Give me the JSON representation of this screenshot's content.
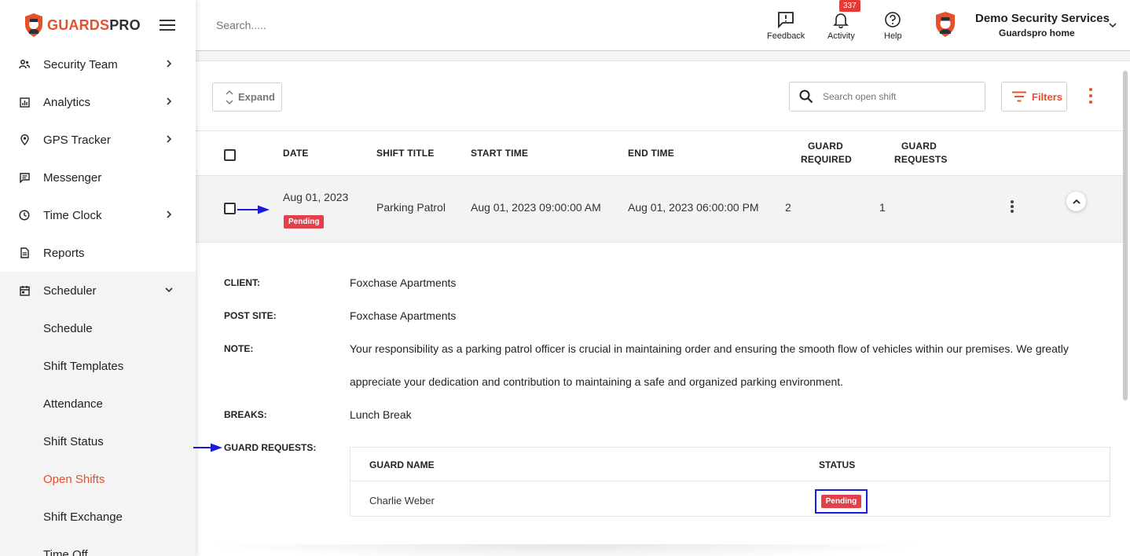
{
  "brand": {
    "part1": "GUARDS",
    "part2": "PRO"
  },
  "sidebar": {
    "items": [
      {
        "label": "Security Team"
      },
      {
        "label": "Analytics"
      },
      {
        "label": "GPS Tracker"
      },
      {
        "label": "Messenger"
      },
      {
        "label": "Time Clock"
      },
      {
        "label": "Reports"
      },
      {
        "label": "Scheduler"
      }
    ],
    "scheduler_sub": [
      {
        "label": "Schedule"
      },
      {
        "label": "Shift Templates"
      },
      {
        "label": "Attendance"
      },
      {
        "label": "Shift Status"
      },
      {
        "label": "Open Shifts"
      },
      {
        "label": "Shift Exchange"
      },
      {
        "label": "Time Off"
      }
    ]
  },
  "topbar": {
    "search_placeholder": "Search.....",
    "feedback": "Feedback",
    "activity": "Activity",
    "activity_count": "337",
    "help": "Help",
    "company": "Demo Security Services",
    "home": "Guardspro home"
  },
  "toolbar": {
    "expand": "Expand",
    "search_placeholder": "Search open shift",
    "filters": "Filters"
  },
  "table": {
    "headers": {
      "date": "DATE",
      "shift_title": "SHIFT TITLE",
      "start_time": "START TIME",
      "end_time": "END TIME",
      "guard_required_1": "GUARD",
      "guard_required_2": "REQUIRED",
      "guard_requests_1": "GUARD",
      "guard_requests_2": "REQUESTS"
    },
    "row": {
      "date": "Aug 01, 2023",
      "status": "Pending",
      "shift_title": "Parking Patrol",
      "start_time": "Aug 01, 2023 09:00:00 AM",
      "end_time": "Aug 01, 2023 06:00:00 PM",
      "guard_required": "2",
      "guard_requests": "1"
    }
  },
  "details": {
    "client_label": "CLIENT:",
    "client": "Foxchase Apartments",
    "post_site_label": "POST SITE:",
    "post_site": "Foxchase Apartments",
    "note_label": "NOTE:",
    "note": "Your responsibility as a parking patrol officer is crucial in maintaining order and ensuring the smooth flow of vehicles within our premises. We greatly appreciate your dedication and contribution to maintaining a safe and organized parking environment.",
    "breaks_label": "BREAKS:",
    "breaks": "Lunch Break",
    "guard_requests_label": "GUARD REQUESTS:",
    "guard_table": {
      "col_name": "GUARD NAME",
      "col_status": "STATUS",
      "rows": [
        {
          "name": "Charlie Weber",
          "status": "Pending"
        }
      ]
    }
  },
  "colors": {
    "accent": "#e8502a",
    "pending": "#e2404a",
    "highlight": "#1a1adb"
  }
}
